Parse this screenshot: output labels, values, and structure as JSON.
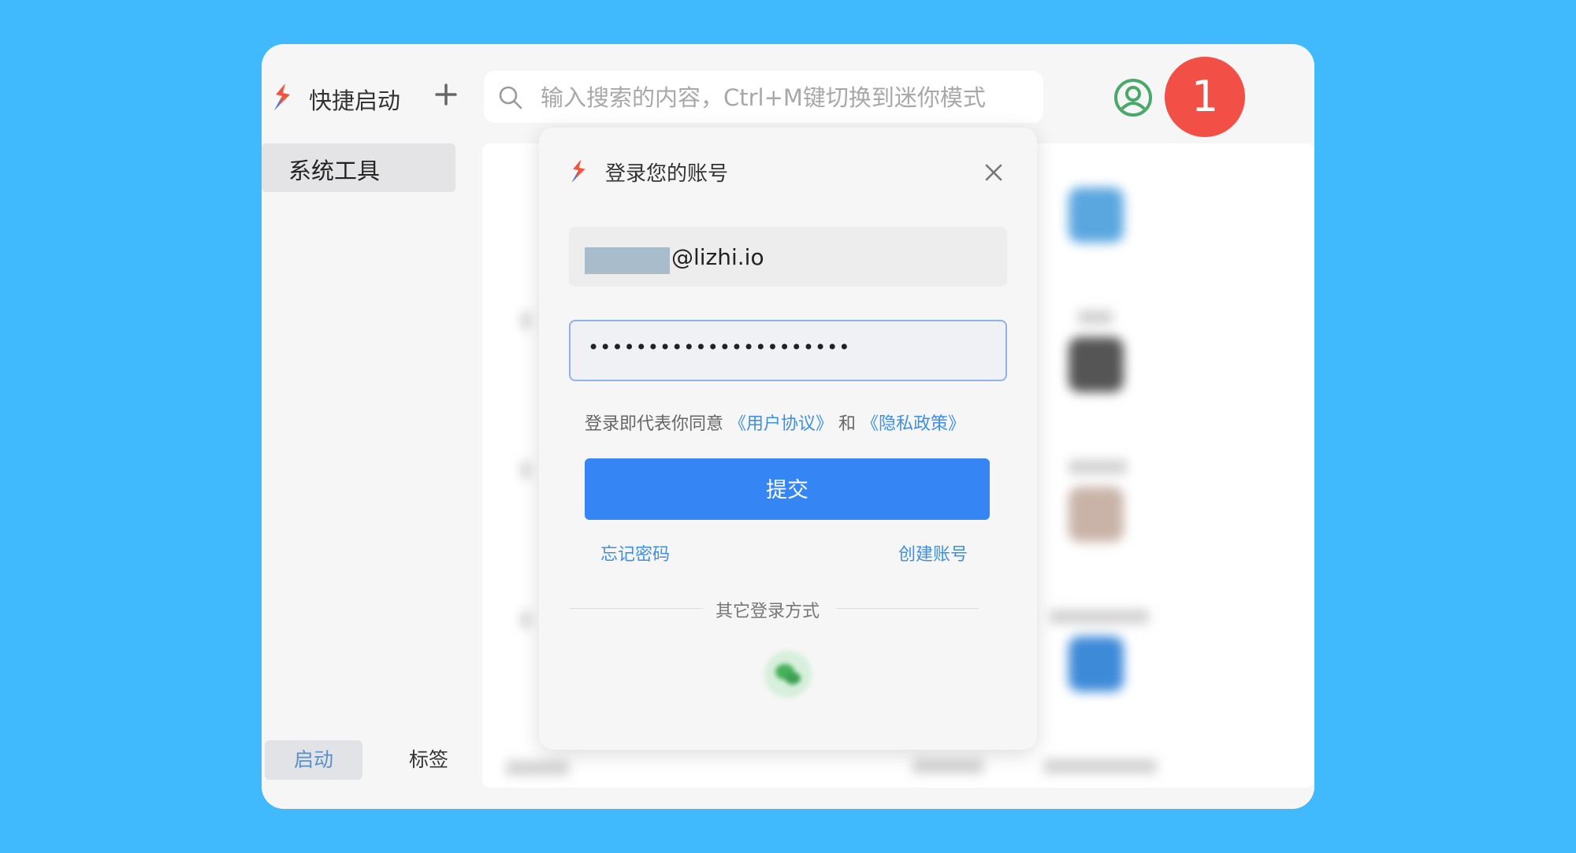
{
  "app": {
    "title": "快捷启动",
    "add_label": "+",
    "search_placeholder": "输入搜索的内容，Ctrl+M键切换到迷你模式",
    "notification_count": "1"
  },
  "sidebar": {
    "items": [
      {
        "label": "系统工具"
      }
    ],
    "tabs": [
      {
        "label": "启动",
        "active": true
      },
      {
        "label": "标签",
        "active": false
      }
    ]
  },
  "login": {
    "title": "登录您的账号",
    "email_value": "@lizhi.io",
    "password_value": "••••••••••••••••••••••",
    "agree_prefix": "登录即代表你同意",
    "user_agreement": "《用户协议》",
    "and_text": "和",
    "privacy_policy": "《隐私政策》",
    "submit_label": "提交",
    "forgot_label": "忘记密码",
    "create_label": "创建账号",
    "other_methods_label": "其它登录方式"
  },
  "colors": {
    "background": "#41b9fd",
    "primary": "#3685f5",
    "link": "#3f8fe6",
    "badge": "#f24f46",
    "user_icon": "#4aa86a"
  },
  "icons": [
    "logo-icon",
    "plus-icon",
    "search-icon",
    "user-icon",
    "close-icon",
    "wechat-icon"
  ]
}
